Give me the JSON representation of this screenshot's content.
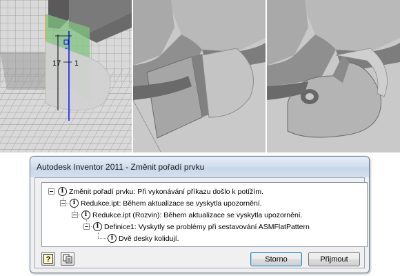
{
  "viewports": {
    "dimension_vertical": "17",
    "dimension_horizontal": "1"
  },
  "dialog": {
    "title": "Autodesk Inventor 2011 - Změnit pořadí prvku",
    "tree": [
      {
        "level": 0,
        "expanded": true,
        "text": "Změnit pořadí prvku: Při vykonávání příkazu došlo k potížím."
      },
      {
        "level": 1,
        "expanded": true,
        "text": "Redukce.ipt: Během aktualizace se vyskytla upozornění."
      },
      {
        "level": 2,
        "expanded": true,
        "text": "Redukce.ipt (Rozvin): Během aktualizace se vyskytla upozornění."
      },
      {
        "level": 3,
        "expanded": true,
        "text": "Definice1: Vyskytly se problémy při sestavování ASMFlatPattern"
      },
      {
        "level": 4,
        "expanded": false,
        "text": "Dvě desky kolidují."
      }
    ],
    "buttons": {
      "cancel": "Storno",
      "accept": "Přijmout"
    },
    "icons": {
      "help": "help-icon",
      "copy": "copy-icon"
    },
    "colors": {
      "accent": "#3c7fb1",
      "sketch_plane": "#7fc37f",
      "dimension_line": "#0000ff"
    }
  }
}
